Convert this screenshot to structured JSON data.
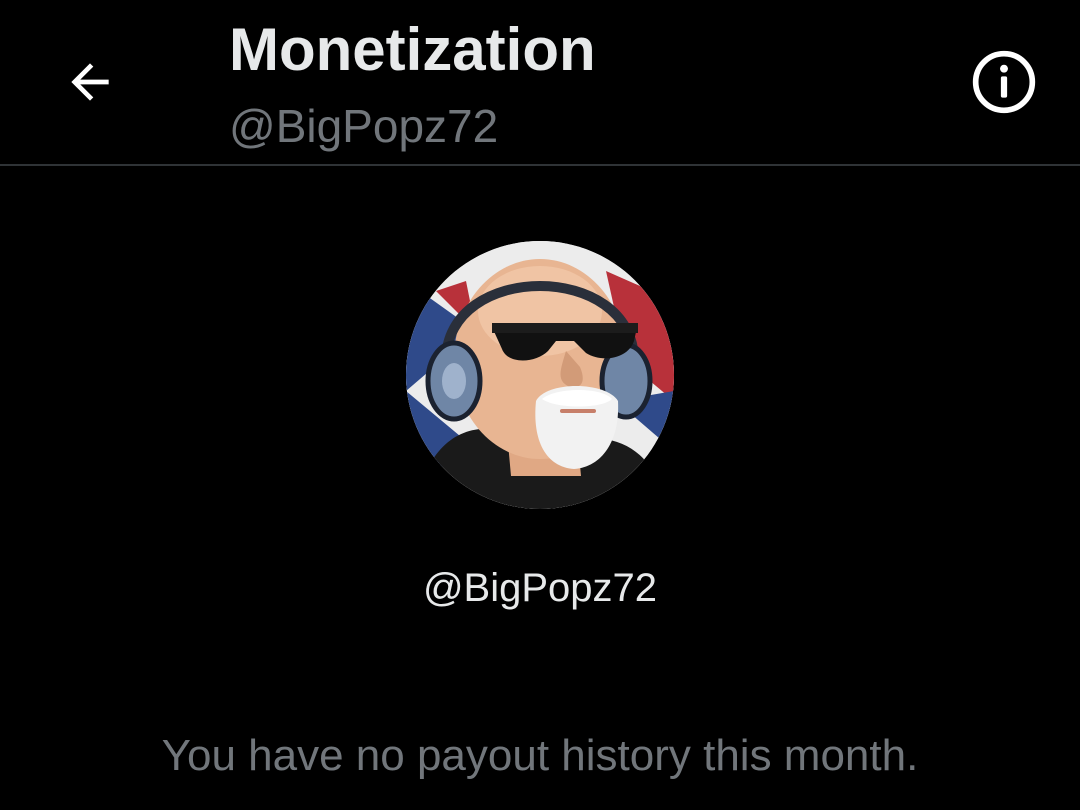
{
  "header": {
    "title": "Monetization",
    "subtitle": "@BigPopz72",
    "back_icon": "arrow-left-icon",
    "info_icon": "info-circle-icon"
  },
  "profile": {
    "handle": "@BigPopz72",
    "avatar": "cartoon bald man with sunglasses, headphones and white goatee"
  },
  "payouts": {
    "empty_message": "You have no payout history this month."
  },
  "colors": {
    "background": "#000000",
    "primary_text": "#e7e9ea",
    "secondary_text": "#71767b",
    "divider": "#2f3336"
  }
}
